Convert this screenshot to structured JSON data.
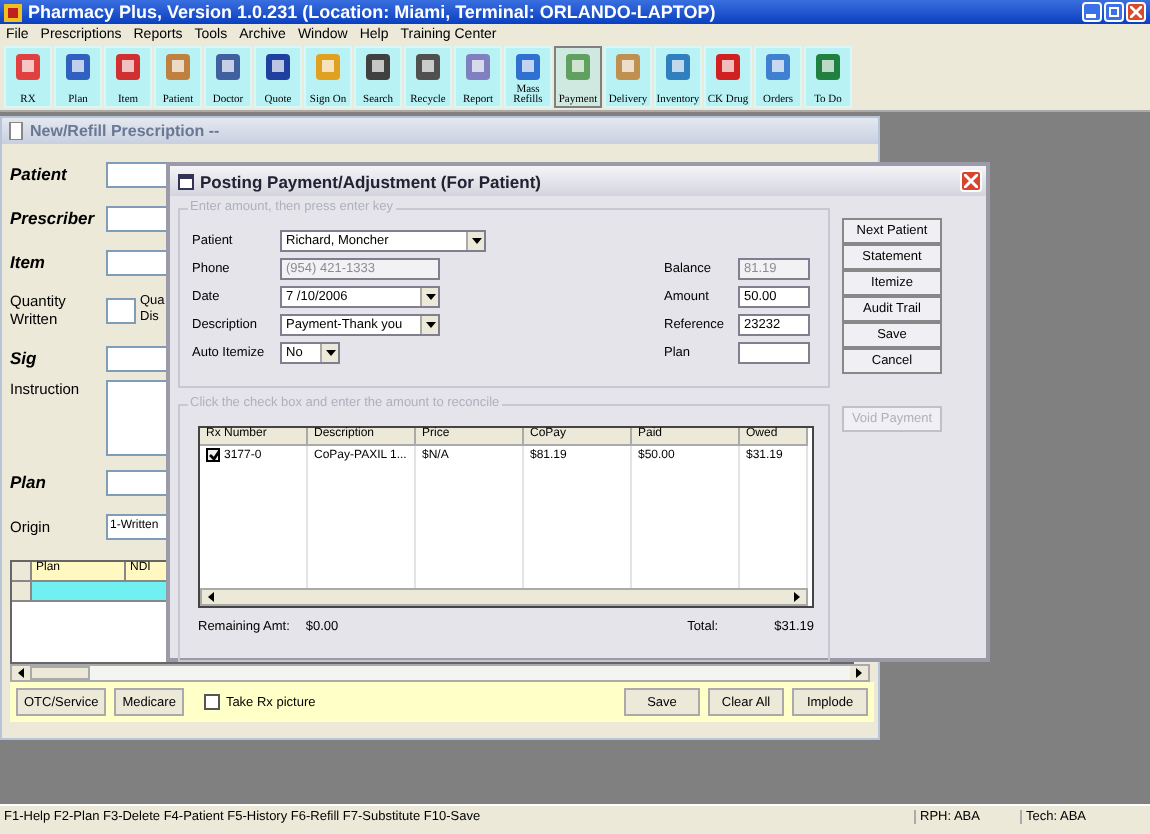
{
  "window": {
    "title": "Pharmacy Plus, Version 1.0.231 (Location: Miami, Terminal: ORLANDO-LAPTOP)"
  },
  "menu": [
    "File",
    "Prescriptions",
    "Reports",
    "Tools",
    "Archive",
    "Window",
    "Help",
    "Training Center"
  ],
  "toolbar": [
    {
      "label": "RX",
      "selected": false
    },
    {
      "label": "Plan",
      "selected": false
    },
    {
      "label": "Item",
      "selected": false
    },
    {
      "label": "Patient",
      "selected": false
    },
    {
      "label": "Doctor",
      "selected": false
    },
    {
      "label": "Quote",
      "selected": false
    },
    {
      "label": "Sign On",
      "selected": false
    },
    {
      "label": "Search",
      "selected": false
    },
    {
      "label": "Recycle",
      "selected": false
    },
    {
      "label": "Report",
      "selected": false
    },
    {
      "label": "Mass Refills",
      "selected": false
    },
    {
      "label": "Payment",
      "selected": true
    },
    {
      "label": "Delivery",
      "selected": false
    },
    {
      "label": "Inventory",
      "selected": false
    },
    {
      "label": "CK Drug",
      "selected": false
    },
    {
      "label": "Orders",
      "selected": false
    },
    {
      "label": "To Do",
      "selected": false
    }
  ],
  "prescription_window": {
    "title": "New/Refill Prescription --",
    "fields": [
      {
        "label": "Patient",
        "kind": "bold"
      },
      {
        "label": "Prescriber",
        "kind": "bold"
      },
      {
        "label": "Item",
        "kind": "bold"
      },
      {
        "label": "Quantity Written",
        "kind": "quantity"
      },
      {
        "label": "Sig",
        "kind": "bold"
      },
      {
        "label": "Instruction",
        "kind": "memo"
      },
      {
        "label": "Plan",
        "kind": "bold"
      },
      {
        "label": "Origin",
        "kind": "value",
        "value": "1-Written"
      }
    ],
    "cut_label_lines": [
      "Qua",
      "Dis"
    ],
    "grid_columns": [
      "Plan",
      "NDI"
    ],
    "buttons": [
      "OTC/Service",
      "Medicare"
    ],
    "take_picture": {
      "label": "Take Rx picture",
      "checked": false
    },
    "right_buttons": [
      "Save",
      "Clear All",
      "Implode"
    ]
  },
  "payment_dialog": {
    "title": "Posting Payment/Adjustment (For Patient)",
    "entry_group": "Enter amount, then press enter key",
    "left_fields": [
      {
        "label": "Patient",
        "value": "Richard, Moncher",
        "kind": "dropdown",
        "disabled": false
      },
      {
        "label": "Phone",
        "value": "(954) 421-1333",
        "kind": "text",
        "disabled": true
      },
      {
        "label": "Date",
        "value": "7 /10/2006",
        "kind": "dropdown",
        "disabled": false
      },
      {
        "label": "Description",
        "value": "Payment-Thank you",
        "kind": "dropdown",
        "disabled": false
      },
      {
        "label": "Auto Itemize",
        "value": "No",
        "kind": "dropdown",
        "disabled": false
      }
    ],
    "right_fields": [
      {
        "label": "Balance",
        "value": "81.19",
        "disabled": true
      },
      {
        "label": "Amount",
        "value": "50.00",
        "disabled": false
      },
      {
        "label": "Reference",
        "value": "23232",
        "disabled": false
      },
      {
        "label": "Plan",
        "disabled": false
      }
    ],
    "buttons": [
      {
        "label": "Next Patient",
        "disabled": false
      },
      {
        "label": "Statement",
        "disabled": false
      },
      {
        "label": "Itemize",
        "disabled": false
      },
      {
        "label": "Audit Trail",
        "disabled": false
      },
      {
        "label": "Save",
        "disabled": false
      },
      {
        "label": "Cancel",
        "disabled": false
      }
    ],
    "reconcile_group": "Click the check box and enter the amount to reconcile",
    "void_button": {
      "label": "Void Payment",
      "disabled": true
    },
    "columns": [
      "Rx Number",
      "Description",
      "Price",
      "CoPay",
      "Paid",
      "Owed"
    ],
    "rows": [
      {
        "checked": true,
        "cells": [
          "3177-0",
          "CoPay-PAXIL 1...",
          "$N/A",
          "$81.19",
          "$50.00",
          "$31.19"
        ]
      }
    ],
    "remaining_label": "Remaining Amt:",
    "remaining_value": "$0.00",
    "total_label": "Total:",
    "total_value": "$31.19"
  },
  "status_bar": {
    "keys": "F1-Help  F2-Plan  F3-Delete  F4-Patient  F5-History  F6-Refill  F7-Substitute  F10-Save",
    "rph": "RPH: ABA",
    "tech": "Tech: ABA"
  }
}
